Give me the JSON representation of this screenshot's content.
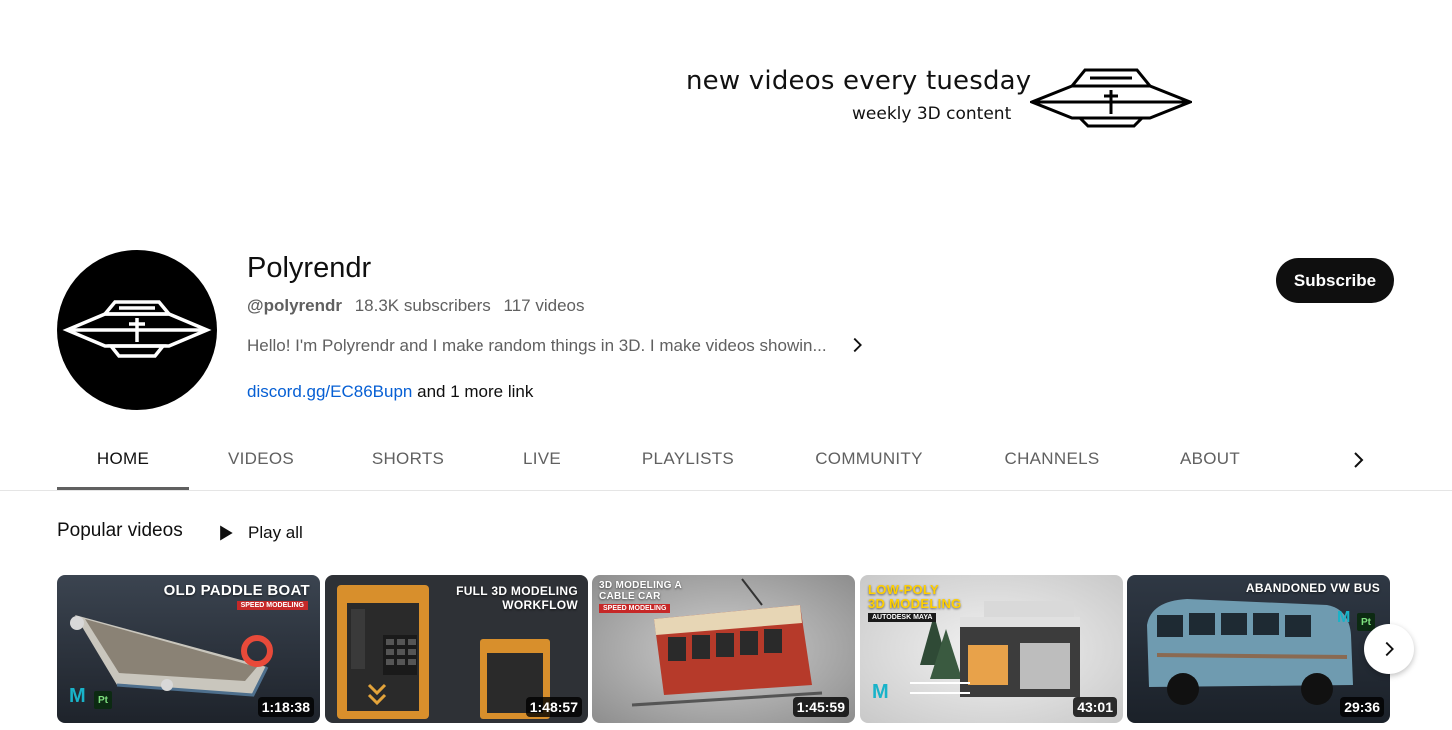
{
  "banner": {
    "line1": "new videos every tuesday",
    "line2": "weekly 3D content",
    "logo_icon": "ufo-logo-icon"
  },
  "channel": {
    "name": "Polyrendr",
    "handle": "@polyrendr",
    "subscribers": "18.3K subscribers",
    "videos": "117 videos",
    "description": "Hello! I'm Polyrendr and I make random things in 3D. I make videos showin...",
    "link": "discord.gg/EC86Bupn",
    "more_links": "and 1 more link",
    "subscribe_label": "Subscribe"
  },
  "tabs": [
    {
      "label": "HOME",
      "active": true
    },
    {
      "label": "VIDEOS"
    },
    {
      "label": "SHORTS"
    },
    {
      "label": "LIVE"
    },
    {
      "label": "PLAYLISTS"
    },
    {
      "label": "COMMUNITY"
    },
    {
      "label": "CHANNELS"
    },
    {
      "label": "ABOUT"
    }
  ],
  "section": {
    "title": "Popular videos",
    "play_all": "Play all"
  },
  "videos": [
    {
      "title_line1": "OLD PADDLE BOAT",
      "tag": "SPEED MODELING",
      "duration": "1:18:38"
    },
    {
      "title_line1": "FULL 3D MODELING",
      "title_line2": "WORKFLOW",
      "duration": "1:48:57"
    },
    {
      "title_line1": "3D MODELING A",
      "title_line2": "CABLE CAR",
      "tag": "SPEED MODELING",
      "duration": "1:45:59"
    },
    {
      "title_line1": "LOW-POLY",
      "title_line2": "3D MODELING",
      "tag": "AUTODESK MAYA",
      "duration": "43:01"
    },
    {
      "title_line1": "ABANDONED VW BUS",
      "duration": "29:36"
    }
  ],
  "colors": {
    "accent_link": "#065fd4",
    "subscribe_bg": "#0f0f0f"
  }
}
